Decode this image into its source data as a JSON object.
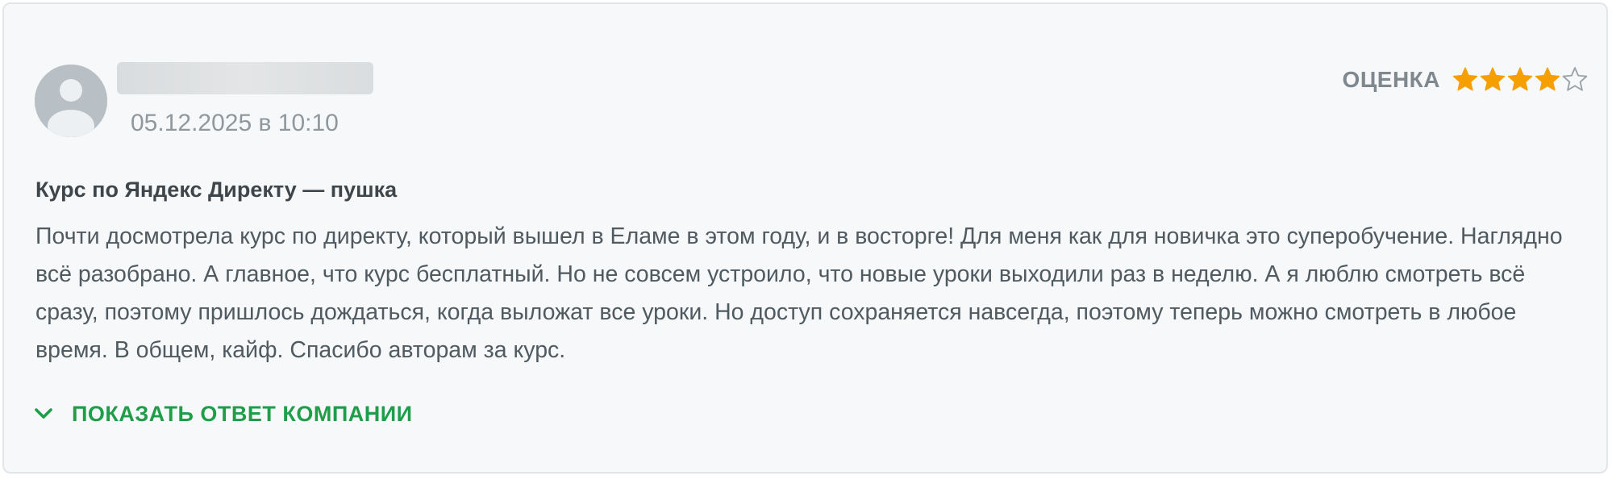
{
  "review": {
    "author": {
      "name": "",
      "date": "05.12.2025 в 10:10"
    },
    "rating": {
      "label": "ОЦЕНКА",
      "value": 4,
      "max": 5,
      "filled_color": "#f5a000",
      "empty_color": "#9aa1a6"
    },
    "title": "Курс по Яндекс Директу — пушка",
    "text": "Почти досмотрела курс по директу, который вышел в Еламе в этом году, и в восторге! Для меня как для новичка это суперобучение. Наглядно всё разобрано. А главное, что курс бесплатный. Но не совсем устроило, что новые уроки выходили раз в неделю. А я люблю смотреть всё сразу, поэтому пришлось дождаться, когда выложат все уроки. Но доступ сохраняется навсегда, поэтому теперь можно смотреть в любое время. В общем, кайф. Спасибо авторам за курс.",
    "show_reply_label": "ПОКАЗАТЬ ОТВЕТ КОМПАНИИ",
    "avatar_icon": "user-avatar-icon",
    "reply_icon": "chevron-down-icon"
  },
  "colors": {
    "accent": "#1f9e4a",
    "card_background": "#f6f8f9",
    "muted_text": "#8f989e"
  }
}
